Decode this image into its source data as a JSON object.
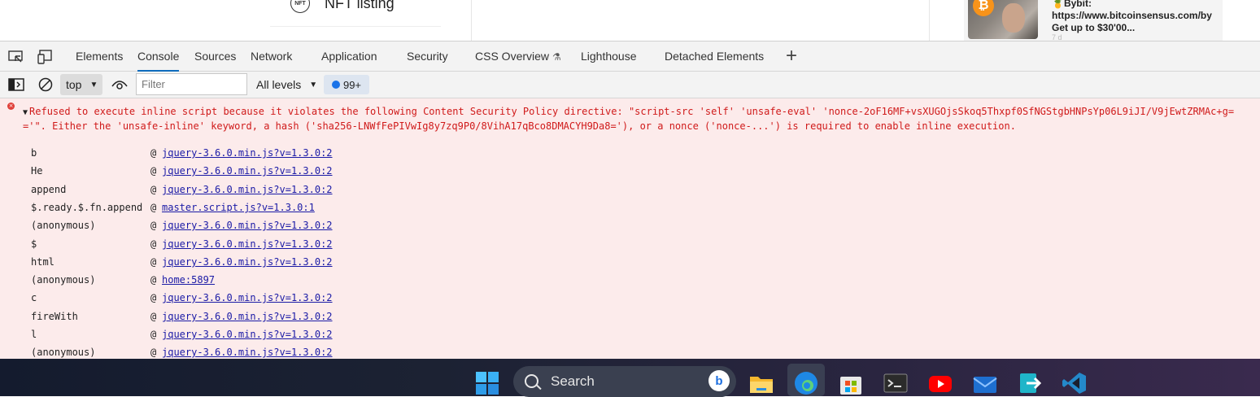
{
  "web_page": {
    "nft_badge": "NFT",
    "nft_listing": "NFT listing",
    "ad": {
      "title": "🍍Bybit:",
      "url": "https://www.bitcoinsensus.com/by",
      "text": "Get up to $30'00...",
      "faded": "7 d"
    }
  },
  "devtools": {
    "tabs": [
      "Elements",
      "Console",
      "Sources",
      "Network",
      "Application",
      "Security",
      "CSS Overview",
      "Lighthouse",
      "Detached Elements"
    ],
    "active_tab": "Console",
    "toolbar": {
      "context": "top",
      "filter_placeholder": "Filter",
      "levels": "All levels",
      "issues_count": "99+"
    }
  },
  "console": {
    "error_message": "Refused to execute inline script because it violates the following Content Security Policy directive: \"script-src 'self' 'unsafe-eval' 'nonce-2oF16MF+vsXUGOjsSkoq5Thxpf0SfNGStgbHNPsYp06L9iJI/V9jEwtZRMAc+g=='\". Either the 'unsafe-inline' keyword, a hash ('sha256-LNWfFePIVwIg8y7zq9P0/8VihA17qBco8DMACYH9Da8='), or a nonce ('nonce-...') is required to enable inline execution.",
    "stack": [
      {
        "fn": "b",
        "src": "jquery-3.6.0.min.js?v=1.3.0:2"
      },
      {
        "fn": "He",
        "src": "jquery-3.6.0.min.js?v=1.3.0:2"
      },
      {
        "fn": "append",
        "src": "jquery-3.6.0.min.js?v=1.3.0:2"
      },
      {
        "fn": "$.ready.$.fn.append",
        "src": "master.script.js?v=1.3.0:1"
      },
      {
        "fn": "(anonymous)",
        "src": "jquery-3.6.0.min.js?v=1.3.0:2"
      },
      {
        "fn": "$",
        "src": "jquery-3.6.0.min.js?v=1.3.0:2"
      },
      {
        "fn": "html",
        "src": "jquery-3.6.0.min.js?v=1.3.0:2"
      },
      {
        "fn": "(anonymous)",
        "src": "home:5897"
      },
      {
        "fn": "c",
        "src": "jquery-3.6.0.min.js?v=1.3.0:2"
      },
      {
        "fn": "fireWith",
        "src": "jquery-3.6.0.min.js?v=1.3.0:2"
      },
      {
        "fn": "l",
        "src": "jquery-3.6.0.min.js?v=1.3.0:2"
      },
      {
        "fn": "(anonymous)",
        "src": "jquery-3.6.0.min.js?v=1.3.0:2"
      }
    ]
  },
  "taskbar": {
    "search_label": "Search",
    "icons": [
      "start-icon",
      "search-icon",
      "bing-icon",
      "file-explorer-icon",
      "edge-icon",
      "store-icon",
      "terminal-icon",
      "youtube-icon",
      "mail-icon",
      "transfer-app-icon",
      "vscode-icon"
    ]
  },
  "colors": {
    "accent": "#0f6cbd",
    "error_text": "#d01a1a",
    "error_bg": "#fcebeb",
    "link": "#1a1aa6"
  }
}
